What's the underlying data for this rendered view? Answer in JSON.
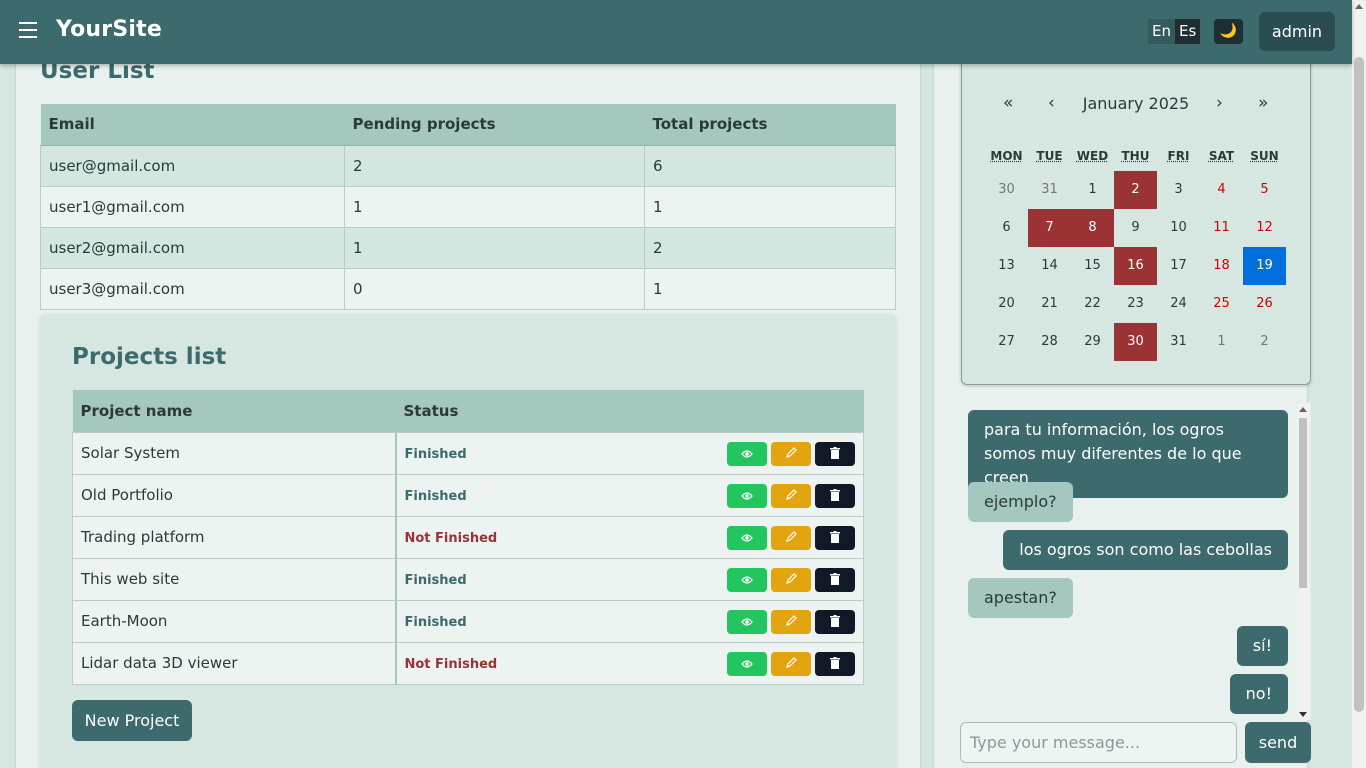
{
  "navbar": {
    "brand": "YourSite",
    "lang_en": "En",
    "lang_es": "Es",
    "theme_icon": "🌙",
    "admin_label": "admin"
  },
  "users": {
    "title": "User List",
    "headers": [
      "Email",
      "Pending projects",
      "Total projects"
    ],
    "rows": [
      [
        "user@gmail.com",
        "2",
        "6"
      ],
      [
        "user1@gmail.com",
        "1",
        "1"
      ],
      [
        "user2@gmail.com",
        "1",
        "2"
      ],
      [
        "user3@gmail.com",
        "0",
        "1"
      ]
    ]
  },
  "projects": {
    "title": "Projects list",
    "headers": [
      "Project name",
      "Status"
    ],
    "rows": [
      {
        "name": "Solar System",
        "status": "Finished"
      },
      {
        "name": "Old Portfolio",
        "status": "Finished"
      },
      {
        "name": "Trading platform",
        "status": "Not Finished"
      },
      {
        "name": "This web site",
        "status": "Finished"
      },
      {
        "name": "Earth-Moon",
        "status": "Finished"
      },
      {
        "name": "Lidar data 3D viewer",
        "status": "Not Finished"
      }
    ],
    "new_button": "New Project",
    "action_icons": [
      "eye-icon",
      "pencil-icon",
      "trash-icon"
    ],
    "colors": {
      "view": "#22c55e",
      "edit": "#e3a50f",
      "delete": "#111827"
    }
  },
  "calendar": {
    "title": "January 2025",
    "nav": {
      "prev_year": "«",
      "prev_month": "‹",
      "next_month": "›",
      "next_year": "»"
    },
    "weekdays": [
      "MON",
      "TUE",
      "WED",
      "THU",
      "FRI",
      "SAT",
      "SUN"
    ],
    "weeks": [
      [
        "30",
        "31",
        "1",
        "2",
        "3",
        "4",
        "5"
      ],
      [
        "6",
        "7",
        "8",
        "9",
        "10",
        "11",
        "12"
      ],
      [
        "13",
        "14",
        "15",
        "16",
        "17",
        "18",
        "19"
      ],
      [
        "20",
        "21",
        "22",
        "23",
        "24",
        "25",
        "26"
      ],
      [
        "27",
        "28",
        "29",
        "30",
        "31",
        "1",
        "2"
      ]
    ],
    "marked_days": [
      "2",
      "7",
      "8",
      "16",
      "30"
    ],
    "today": "19",
    "colors": {
      "marked": "#9b3234",
      "today": "#006edc",
      "weekend": "#d10000"
    }
  },
  "chat": {
    "messages": [
      {
        "from": "me",
        "text": "para tu información, los ogros somos muy diferentes de lo que creen"
      },
      {
        "from": "them",
        "text": "ejemplo?"
      },
      {
        "from": "me",
        "text": "los ogros son como las cebollas"
      },
      {
        "from": "them",
        "text": "apestan?"
      },
      {
        "from": "me",
        "text": "sí!"
      },
      {
        "from": "me",
        "text": "no!"
      }
    ],
    "input_placeholder": "Type your message...",
    "send_label": "send"
  }
}
